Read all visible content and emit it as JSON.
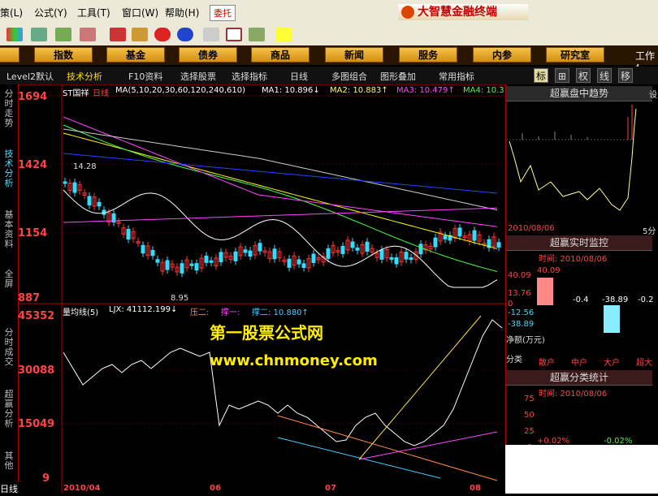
{
  "menu": {
    "items": [
      "策(L)",
      "公式(Y)",
      "工具(T)",
      "窗口(W)",
      "帮助(H)"
    ],
    "delegate": "委托",
    "brand": "大智慧金融终端"
  },
  "nav": {
    "buttons": [
      "指数",
      "基金",
      "债券",
      "商品",
      "新闻",
      "服务",
      "内参",
      "研究室"
    ],
    "right_label": "工作ℓ"
  },
  "subbar": {
    "items": [
      "Level2默认",
      "技术分析",
      "F10资料",
      "选择股票",
      "选择指标",
      "日线",
      "多图组合",
      "图形叠加",
      "常用指标"
    ],
    "view_tabs": [
      "标",
      "⊞",
      "权",
      "线",
      "移"
    ]
  },
  "sidebar": {
    "tabs": [
      "分时走势",
      "技术分析",
      "基本资料",
      "全屏",
      "分时成交",
      "超赢分析",
      "其他"
    ],
    "bottom_tab": "日线"
  },
  "main": {
    "stock_name": "ST国祥",
    "period": "日线",
    "ma_label": "MA(5,10,20,30,60,120,240,610)",
    "ma1": "MA1: 10.896↓",
    "ma2": "MA2: 10.883↑",
    "ma3": "MA3: 10.479↑",
    "ma4": "MA4: 10.3",
    "price_ticks": [
      "1694",
      "1424",
      "1154",
      "887"
    ],
    "high_mark": "14.28",
    "low_mark": "8.95",
    "vol_title": "量均线(5)",
    "ljx": "LJX: 41112.199↓",
    "ya2": "压二:",
    "cheng1": "撑一:",
    "cheng2": "撑二: 10.880↑",
    "vol_ticks": [
      "45352",
      "30088",
      "15049",
      "9"
    ],
    "date_labels": [
      "2010/04",
      "06",
      "07",
      "08"
    ],
    "watermark1": "第一股票公式网",
    "watermark2": "www.chnmoney.com",
    "colors": {
      "up": "#ff3333",
      "down": "#33ddff",
      "ma1": "#ffffff",
      "ma2": "#ffff00",
      "ma3": "#ff44ff",
      "ma4": "#44ff44",
      "ma5": "#cccccc",
      "ma6": "#2244ff",
      "ma7": "#ff44ff"
    }
  },
  "right": {
    "panel1_title": "超赢盘中趋势",
    "panel1_date": "2010/08/06",
    "panel1_right": "5分",
    "panel2_title": "超赢实时监控",
    "panel2_time": "时间: 2010/08/06",
    "p2_ticks": [
      "40.09",
      "13.76",
      "0",
      "-12.56",
      "-38.89"
    ],
    "p2_values": [
      "40.09",
      "-0.4",
      "-38.89",
      "-0.2"
    ],
    "net_label": "净额(万元)",
    "categories": [
      "分类",
      "散户",
      "中户",
      "大户",
      "超大"
    ],
    "panel3_title": "超赢分类统计",
    "panel3_time": "时间: 2010/08/06",
    "p3_ticks": [
      "75",
      "50",
      "25",
      "0"
    ],
    "p3_values": [
      "+0.02%",
      "-0.02%"
    ],
    "right_edge": "设"
  }
}
